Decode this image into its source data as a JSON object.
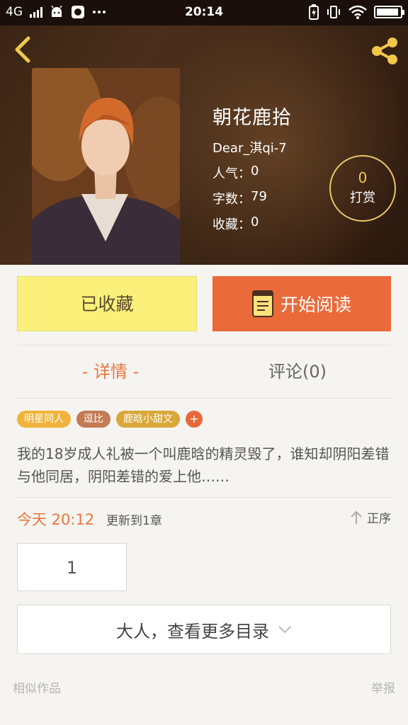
{
  "status_bar": {
    "network": "4G",
    "time": "20:14"
  },
  "book": {
    "title": "朝花鹿拾",
    "author": "Dear_淇qi-7",
    "stats": [
      {
        "label": "人气：",
        "value": "0"
      },
      {
        "label": "字数：",
        "value": "79"
      },
      {
        "label": "收藏：",
        "value": "0"
      }
    ]
  },
  "reward": {
    "count": "0",
    "label": "打赏"
  },
  "actions": {
    "favorite": "已收藏",
    "read": "开始阅读"
  },
  "tabs": {
    "detail": "- 详情 -",
    "comments": "评论(0)"
  },
  "tags": [
    {
      "label": "明星同人",
      "color": "#f2b33d"
    },
    {
      "label": "逗比",
      "color": "#c47a55"
    },
    {
      "label": "鹿晗小甜文",
      "color": "#d9a83a"
    }
  ],
  "tag_add": "+",
  "summary": "我的18岁成人礼被一个叫鹿晗的精灵毁了，谁知却阴阳差错与他同居，阴阳差错的爱上他……",
  "update": {
    "date": "今天 20:12",
    "note": "更新到1章",
    "sort": "正序"
  },
  "chapters": [
    "1"
  ],
  "more": "大人，查看更多目录",
  "footer": {
    "similar": "相似作品",
    "report": "举报"
  },
  "colors": {
    "accent": "#ea6a3a",
    "favorite_bg": "#fbf07a",
    "highlight": "#e8773f"
  }
}
